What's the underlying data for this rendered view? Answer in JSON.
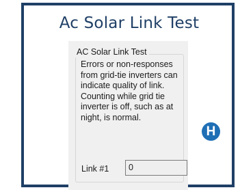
{
  "header": {
    "title": "Ac Solar Link Test"
  },
  "group": {
    "title": "AC  Solar Link Test",
    "description_lines": [
      "Errors or non-responses",
      "from grid-tie inverters can",
      "indicate quality of link.",
      "Counting while grid tie",
      "inverter is off, such as at",
      "night, is normal."
    ]
  },
  "link": {
    "label": "Link #1",
    "value": "0"
  },
  "callout": {
    "letter": "H"
  },
  "colors": {
    "frame": "#1f3f66",
    "callout": "#1f6fb5",
    "window_bg": "#f0f0f0"
  }
}
